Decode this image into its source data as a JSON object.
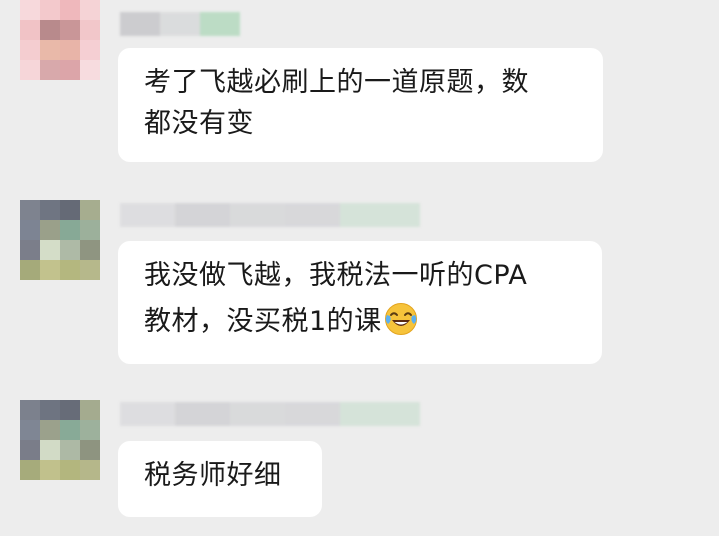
{
  "messages": [
    {
      "id": "msg-1",
      "text": "考了飞越必刷上的一道原题，数都没有变",
      "line1": "考了飞越必刷上的一道原题，数",
      "line2": "都没有变"
    },
    {
      "id": "msg-2",
      "text": "我没做飞越，我税法一听的CPA教材，没买税1的课",
      "line1": "我没做飞越，我税法一听的CPA",
      "line2": "教材，没买税1的课",
      "emoji": "face-with-tears-of-joy-icon"
    },
    {
      "id": "msg-3",
      "text": "税务师好细",
      "line1": "税务师好细"
    }
  ],
  "colors": {
    "background": "#ededed",
    "bubble": "#ffffff",
    "text": "#1a1a1a"
  }
}
